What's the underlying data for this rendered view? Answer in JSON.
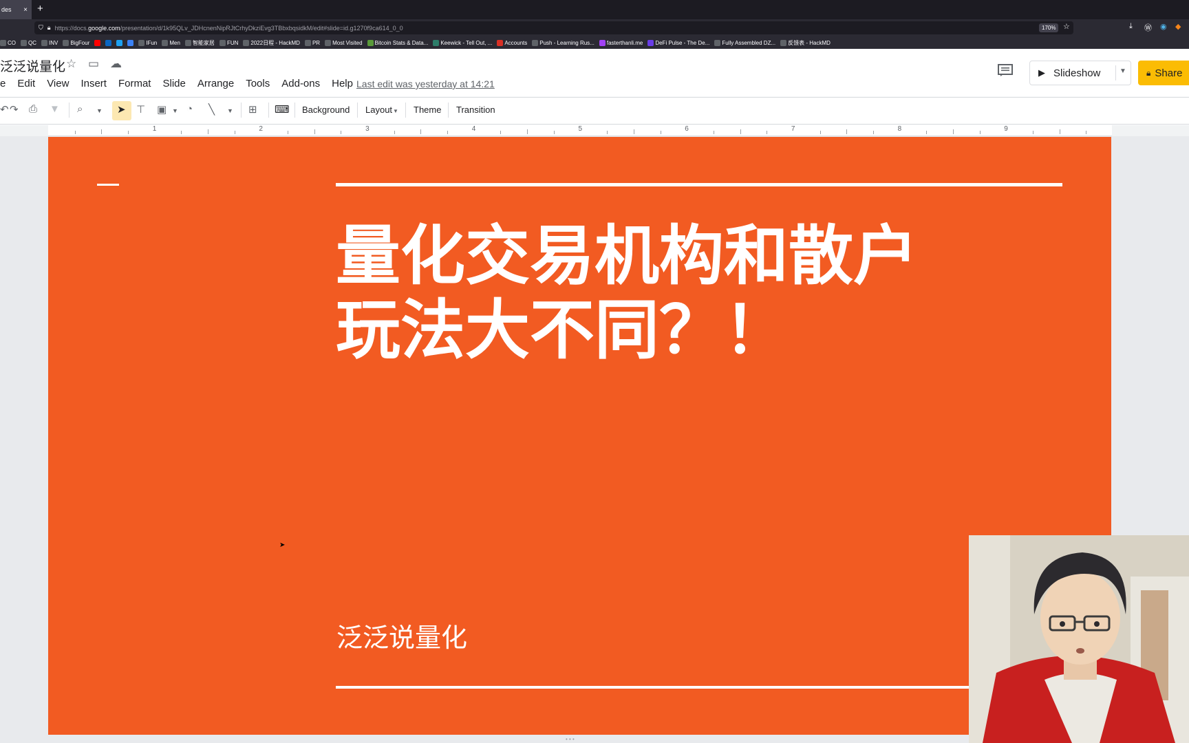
{
  "browser": {
    "tab_label": "des",
    "tab_close": "×",
    "new_tab": "+",
    "url_prefix": "https://docs.",
    "url_domain": "google.com",
    "url_path": "/presentation/d/1k95QLv_JDHcnenNipRJtCrhyDkziEvg3TBbxbqsidkM/edit#slide=id.g1270f9ca614_0_0",
    "zoom": "170%",
    "bookmarks": [
      {
        "label": "CO",
        "color": "#5f6368"
      },
      {
        "label": "QC",
        "color": "#5f6368"
      },
      {
        "label": "INV",
        "color": "#5f6368"
      },
      {
        "label": "BigFour",
        "color": "#5f6368"
      },
      {
        "label": "",
        "color": "#ff0000"
      },
      {
        "label": "",
        "color": "#0a66c2"
      },
      {
        "label": "",
        "color": "#1da1f2"
      },
      {
        "label": "",
        "color": "#3b82f6"
      },
      {
        "label": "IFun",
        "color": "#5f6368"
      },
      {
        "label": "Men",
        "color": "#5f6368"
      },
      {
        "label": "智能家居",
        "color": "#5f6368"
      },
      {
        "label": "FUN",
        "color": "#5f6368"
      },
      {
        "label": "2022日程 - HackMD",
        "color": "#5f6368"
      },
      {
        "label": "PR",
        "color": "#5f6368"
      },
      {
        "label": "Most Visited",
        "color": "#5f6368"
      },
      {
        "label": "Bitcoin Stats & Data...",
        "color": "#5a9a3a"
      },
      {
        "label": "Keewick - Tell Out, ...",
        "color": "#2d7d6a"
      },
      {
        "label": "Accounts",
        "color": "#d93025"
      },
      {
        "label": "Push - Learning Rus...",
        "color": "#5f6368"
      },
      {
        "label": "fasterthanli.me",
        "color": "#a142f4"
      },
      {
        "label": "DeFi Pulse - The De...",
        "color": "#6a3de8"
      },
      {
        "label": "Fully Assembled DZ...",
        "color": "#5f6368"
      },
      {
        "label": "反馈表 - HackMD",
        "color": "#5f6368"
      }
    ]
  },
  "docs": {
    "title": "泛泛说量化",
    "menu": [
      "e",
      "Edit",
      "View",
      "Insert",
      "Format",
      "Slide",
      "Arrange",
      "Tools",
      "Add-ons",
      "Help"
    ],
    "last_edit": "Last edit was yesterday at 14:21",
    "slideshow_label": "Slideshow",
    "share_label": "Share",
    "toolbar": {
      "background": "Background",
      "layout": "Layout",
      "theme": "Theme",
      "transition": "Transition"
    },
    "ruler_numbers": [
      "1",
      "2",
      "3",
      "4",
      "5",
      "6",
      "7",
      "8",
      "9"
    ]
  },
  "slide": {
    "background_color": "#f25b22",
    "title_line1": "量化交易机构和散户",
    "title_line2": "玩法大不同？！",
    "subtitle": "泛泛说量化"
  }
}
